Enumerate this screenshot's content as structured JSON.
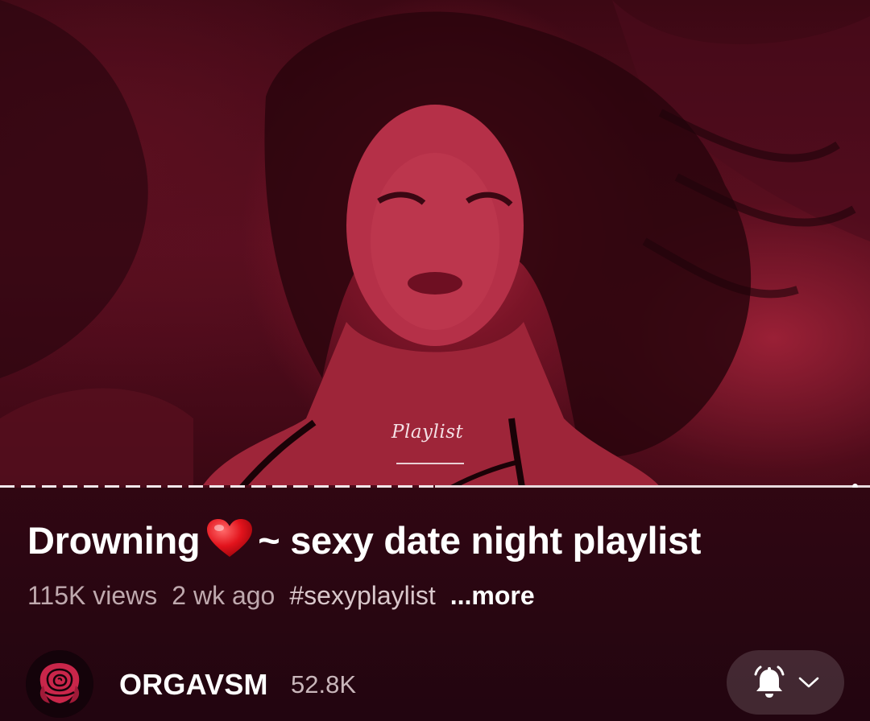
{
  "player": {
    "overlay_caption": "Playlist",
    "progress_fraction": 0.98
  },
  "video": {
    "title_left": "Drowning",
    "title_emoji": "heart-icon",
    "title_right": "~  sexy date night playlist",
    "views": "115K views",
    "age": "2 wk ago",
    "hashtag": "#sexyplaylist",
    "more_label": "...more"
  },
  "channel": {
    "name": "ORGAVSM",
    "subscribers": "52.8K",
    "avatar_icon": "rose-icon"
  },
  "subscribe": {
    "bell_icon": "bell-ring-icon",
    "dropdown_icon": "chevron-down-icon"
  },
  "colors": {
    "background": "#3a0814",
    "accent": "#c9264a",
    "text": "#ffffff"
  }
}
